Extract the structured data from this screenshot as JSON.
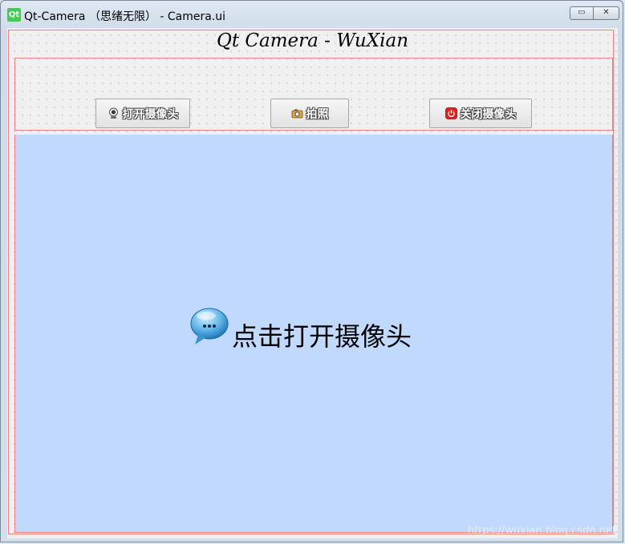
{
  "window": {
    "app_icon_text": "Qt",
    "title": "Qt-Camera （思绪无限） - Camera.ui",
    "minimize_glyph": "▭",
    "close_glyph": "✕"
  },
  "form": {
    "title": "Qt Camera - WuXian"
  },
  "toolbar": {
    "open_camera_label": "打开摄像头",
    "open_camera_icon": "webcam-icon",
    "capture_label": "拍照",
    "capture_icon": "camera-icon",
    "close_camera_label": "关闭摄像头",
    "close_camera_icon": "power-icon"
  },
  "display": {
    "prompt_text": "点击打开摄像头",
    "prompt_icon": "chat-bubble-icon",
    "background_color": "#c0d9fc"
  },
  "watermark": "https://wuxian.blog.csdn.net"
}
